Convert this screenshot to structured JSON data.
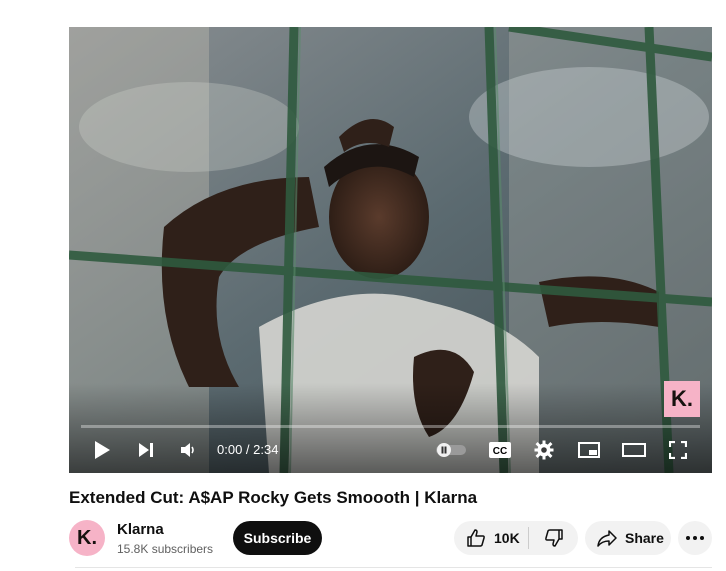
{
  "player": {
    "watermark": "K.",
    "time_text": "0:00 / 2:34",
    "progress": 0.0
  },
  "video": {
    "title": "Extended Cut: A$AP Rocky Gets Smoooth | Klarna"
  },
  "channel": {
    "avatar_letter": "K.",
    "name": "Klarna",
    "subscribers": "15.8K subscribers",
    "subscribe_label": "Subscribe"
  },
  "actions": {
    "like_count": "10K",
    "share_label": "Share"
  },
  "icons": {
    "play": "play-icon",
    "next": "next-icon",
    "volume": "volume-icon",
    "autoplay": "autoplay-toggle-icon",
    "captions": "captions-icon",
    "settings": "gear-icon",
    "miniplayer": "miniplayer-icon",
    "theater": "theater-icon",
    "fullscreen": "fullscreen-icon",
    "like": "thumbs-up-icon",
    "dislike": "thumbs-down-icon",
    "share": "share-arrow-icon",
    "more": "more-horizontal-icon"
  },
  "colors": {
    "brand_pink": "#f6b3c7",
    "subscribe_bg": "#0f0f0f",
    "pill_bg": "#f2f2f2"
  }
}
